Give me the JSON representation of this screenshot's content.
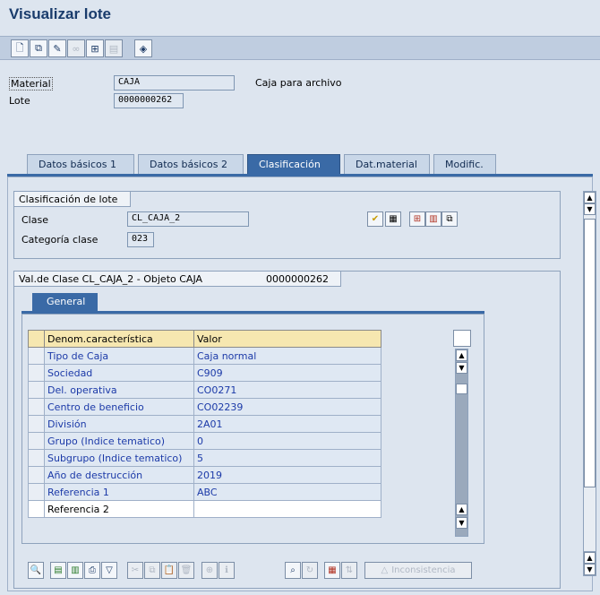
{
  "title": "Visualizar lote",
  "toolbar": [
    {
      "icon": "new-document-icon",
      "glyph": "🗋",
      "disabled": false
    },
    {
      "icon": "copy-icon",
      "glyph": "⧉",
      "disabled": false
    },
    {
      "icon": "pencil-icon",
      "glyph": "✎",
      "disabled": false
    },
    {
      "icon": "glasses-icon",
      "glyph": "∞",
      "disabled": true
    },
    {
      "icon": "tree-icon",
      "glyph": "⊞",
      "disabled": false
    },
    {
      "icon": "grid-icon",
      "glyph": "▤",
      "disabled": true
    },
    {
      "icon": "eraser-icon",
      "glyph": "◈",
      "disabled": false
    }
  ],
  "header": {
    "material_label": "Material",
    "material_value": "CAJA",
    "material_desc": "Caja para archivo",
    "lote_label": "Lote",
    "lote_value": "0000000262"
  },
  "tabs": [
    "Datos básicos 1",
    "Datos básicos 2",
    "Clasificación",
    "Dat.material",
    "Modific."
  ],
  "active_tab": "Clasificación",
  "clasificacion": {
    "group_title": "Clasificación de lote",
    "clase_label": "Clase",
    "clase_value": "CL_CAJA_2",
    "categoria_label": "Categoría clase",
    "categoria_value": "023"
  },
  "valores": {
    "group_title": "Val.de Clase CL_CAJA_2 - Objeto CAJA",
    "object_value": "0000000262",
    "subtab": "General",
    "columns": [
      "Denom.característica",
      "Valor"
    ],
    "rows": [
      {
        "name": "Tipo de Caja",
        "value": "Caja normal"
      },
      {
        "name": "Sociedad",
        "value": "C909"
      },
      {
        "name": "Del. operativa",
        "value": "CO0271"
      },
      {
        "name": "Centro de beneficio",
        "value": "CO02239"
      },
      {
        "name": "División",
        "value": "2A01"
      },
      {
        "name": "Grupo (Indice tematico)",
        "value": "0"
      },
      {
        "name": "Subgrupo (Indice tematico)",
        "value": "5"
      },
      {
        "name": "Año de destrucción",
        "value": "2019"
      },
      {
        "name": "Referencia 1",
        "value": "ABC"
      }
    ],
    "empty_row_name": "Referencia 2"
  },
  "bottom": {
    "inconsistencia_label": "Inconsistencia"
  },
  "colors": {
    "accent": "#3a6aa6",
    "title": "#1a3c6c",
    "header_row": "#f6e7b0"
  }
}
